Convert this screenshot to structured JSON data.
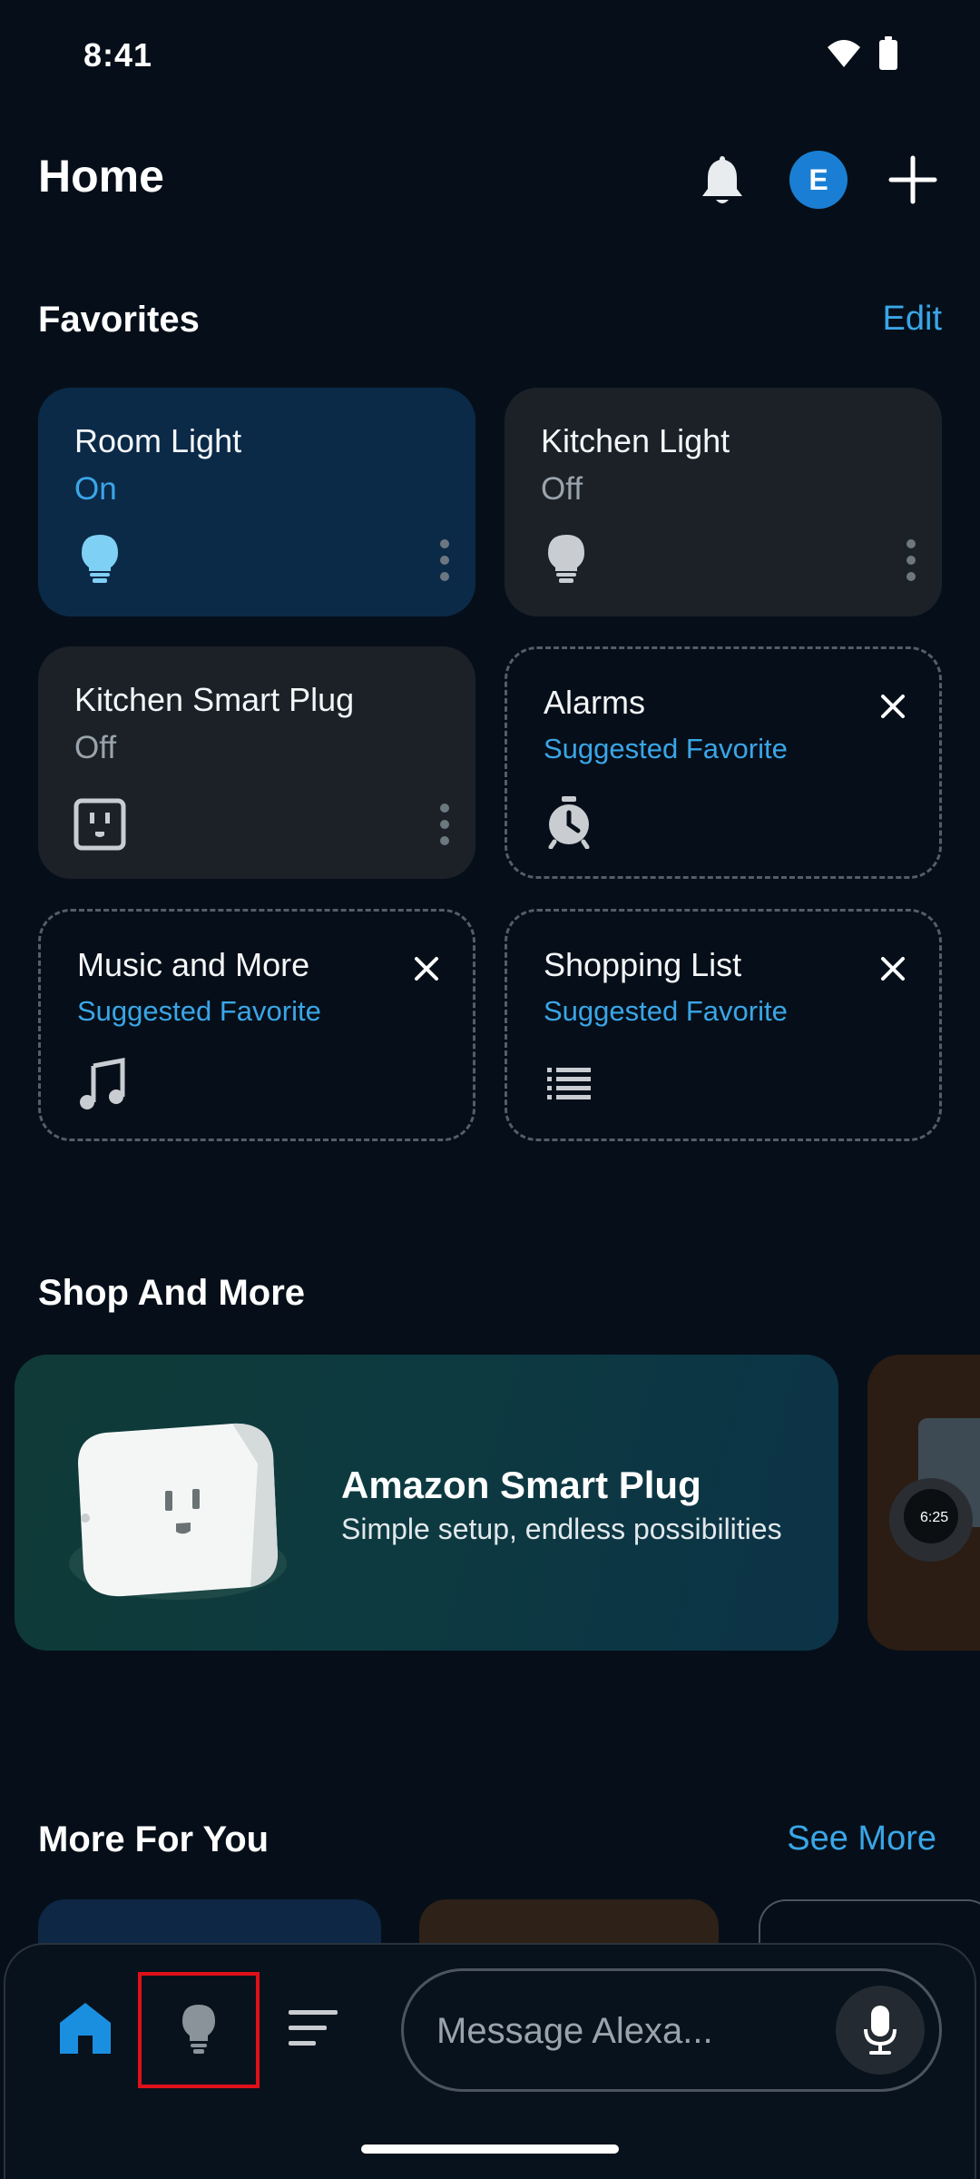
{
  "status": {
    "time": "8:41"
  },
  "header": {
    "title": "Home",
    "avatar_initial": "E"
  },
  "favorites": {
    "title": "Favorites",
    "edit_label": "Edit",
    "tiles": [
      {
        "name": "Room Light",
        "state": "On",
        "icon": "lightbulb-icon"
      },
      {
        "name": "Kitchen Light",
        "state": "Off",
        "icon": "lightbulb-icon"
      },
      {
        "name": "Kitchen Smart Plug",
        "state": "Off",
        "icon": "smart-plug-icon"
      },
      {
        "name": "Alarms",
        "state": "Suggested Favorite",
        "icon": "alarm-clock-icon"
      },
      {
        "name": "Music and More",
        "state": "Suggested Favorite",
        "icon": "music-note-icon"
      },
      {
        "name": "Shopping List",
        "state": "Suggested Favorite",
        "icon": "list-icon"
      }
    ]
  },
  "shop": {
    "title": "Shop And More",
    "promo": {
      "title": "Amazon Smart Plug",
      "subtitle": "Simple setup, endless possibilities",
      "device_time": "6:25"
    }
  },
  "more_for_you": {
    "title": "More For You",
    "see_more_label": "See More"
  },
  "bottom_nav": {
    "message_placeholder": "Message Alexa..."
  },
  "colors": {
    "accent": "#3aa6e8",
    "background": "#060f19",
    "tile": "#1b2127",
    "tile_on": "#0b2a48",
    "highlight": "#e0101a"
  }
}
